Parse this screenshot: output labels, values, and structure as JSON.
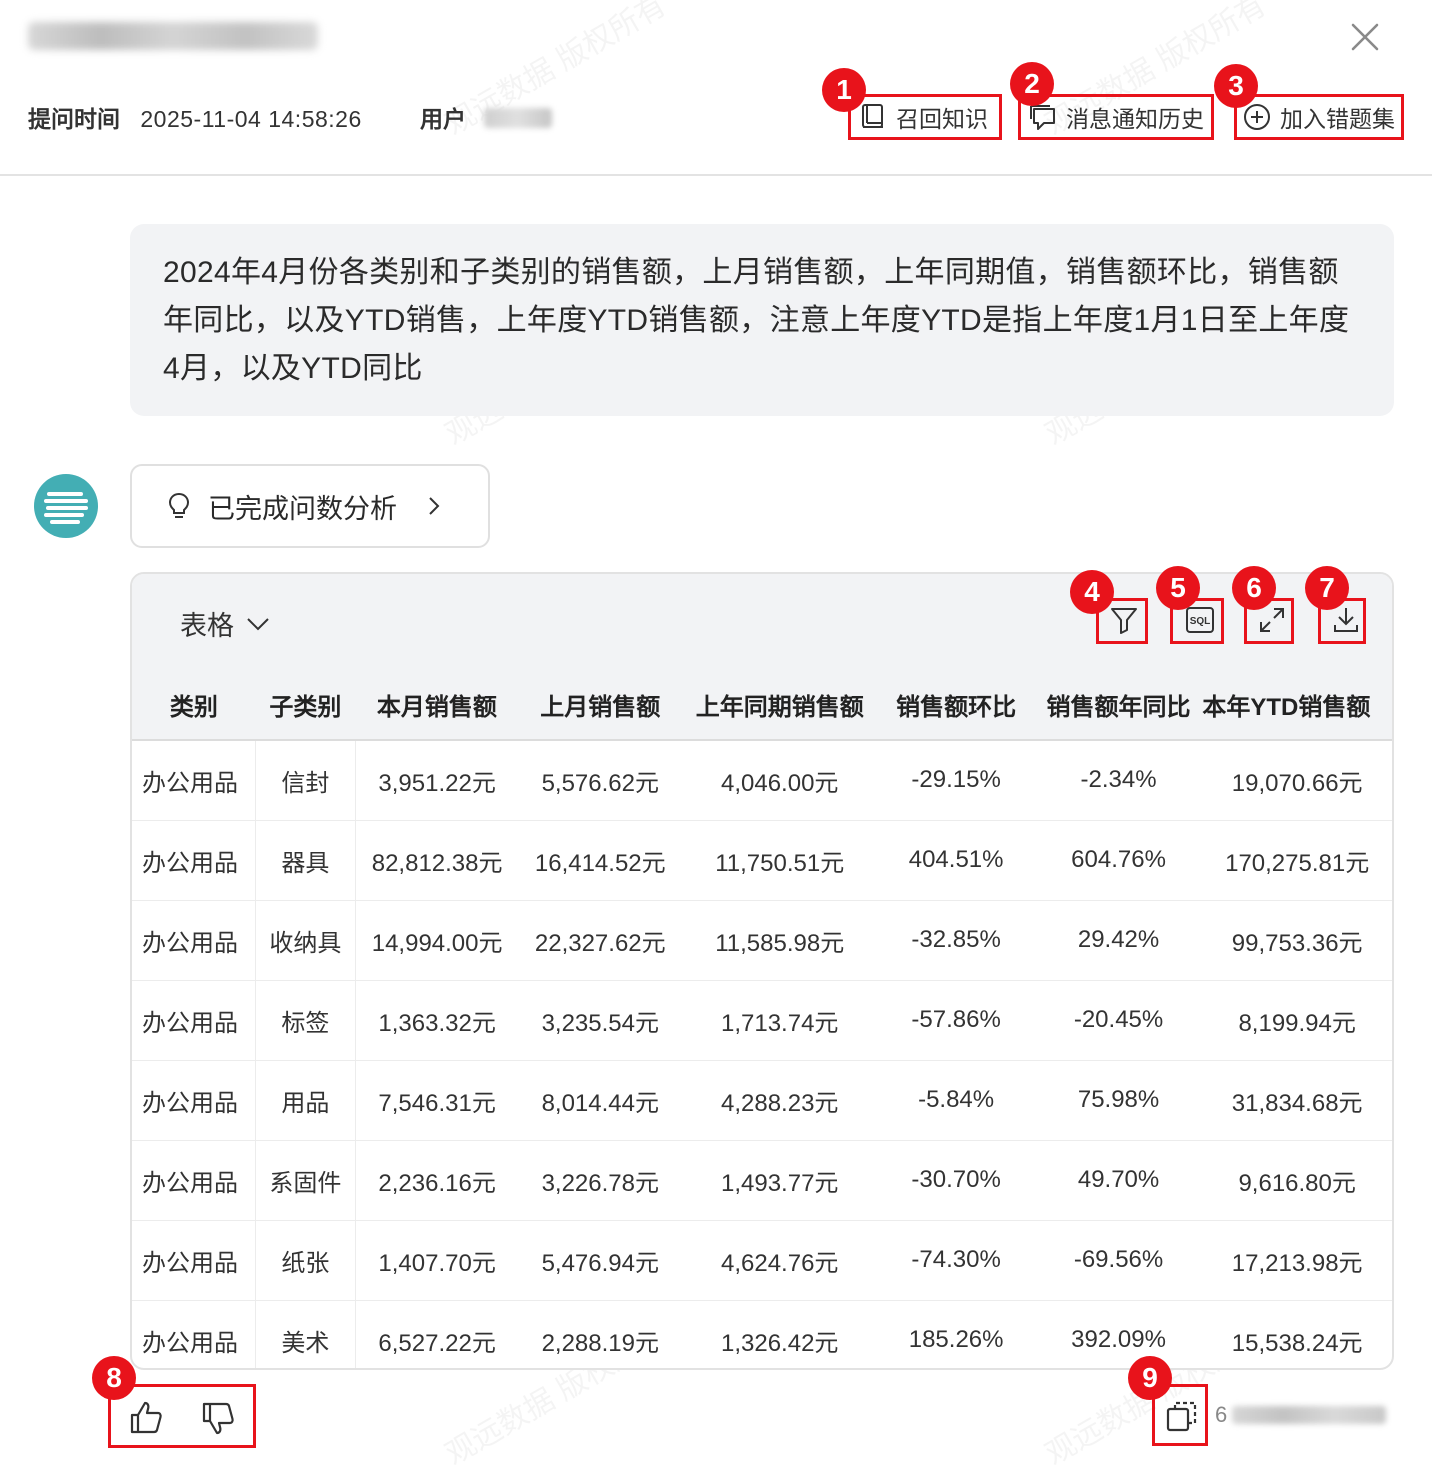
{
  "header": {
    "question_time_label": "提问时间",
    "question_time_value": "2025-11-04 14:58:26",
    "user_label": "用户",
    "buttons": {
      "recall": "召回知识",
      "notify_history": "消息通知历史",
      "add_to_errors": "加入错题集"
    }
  },
  "question": "2024年4月份各类别和子类别的销售额，上月销售额，上年同期值，销售额环比，销售额年同比，以及YTD销售，上年度YTD销售额，注意上年度YTD是指上年度1月1日至上年度4月，以及YTD同比",
  "analysis_button": "已完成问数分析",
  "table_card": {
    "view_label": "表格",
    "columns": [
      "类别",
      "子类别",
      "本月销售额",
      "上月销售额",
      "上年同期销售额",
      "销售额环比",
      "销售额年同比",
      "本年YTD销售额"
    ],
    "rows": [
      [
        "办公用品",
        "信封",
        "3,951.22元",
        "5,576.62元",
        "4,046.00元",
        "-29.15%",
        "-2.34%",
        "19,070.66元"
      ],
      [
        "办公用品",
        "器具",
        "82,812.38元",
        "16,414.52元",
        "11,750.51元",
        "404.51%",
        "604.76%",
        "170,275.81元"
      ],
      [
        "办公用品",
        "收纳具",
        "14,994.00元",
        "22,327.62元",
        "11,585.98元",
        "-32.85%",
        "29.42%",
        "99,753.36元"
      ],
      [
        "办公用品",
        "标签",
        "1,363.32元",
        "3,235.54元",
        "1,713.74元",
        "-57.86%",
        "-20.45%",
        "8,199.94元"
      ],
      [
        "办公用品",
        "用品",
        "7,546.31元",
        "8,014.44元",
        "4,288.23元",
        "-5.84%",
        "75.98%",
        "31,834.68元"
      ],
      [
        "办公用品",
        "系固件",
        "2,236.16元",
        "3,226.78元",
        "1,493.77元",
        "-30.70%",
        "49.70%",
        "9,616.80元"
      ],
      [
        "办公用品",
        "纸张",
        "1,407.70元",
        "5,476.94元",
        "4,624.76元",
        "-74.30%",
        "-69.56%",
        "17,213.98元"
      ],
      [
        "办公用品",
        "美术",
        "6,527.22元",
        "2,288.19元",
        "1,326.42元",
        "185.26%",
        "392.09%",
        "15,538.24元"
      ]
    ]
  },
  "footer": {
    "visible_text": "6"
  },
  "badges": [
    "1",
    "2",
    "3",
    "4",
    "5",
    "6",
    "7",
    "8",
    "9"
  ],
  "watermark": "观远数据 版权所有",
  "colors": {
    "accent_red": "#e8131b",
    "avatar_teal": "#43aeb4",
    "panel_gray": "#f2f3f5"
  },
  "icons": [
    "close-icon",
    "book-icon",
    "message-icon",
    "plus-circle-icon",
    "lightbulb-icon",
    "chevron-right-icon",
    "chevron-down-icon",
    "filter-icon",
    "sql-icon",
    "expand-icon",
    "download-icon",
    "thumbs-up-icon",
    "thumbs-down-icon",
    "copy-icon"
  ]
}
